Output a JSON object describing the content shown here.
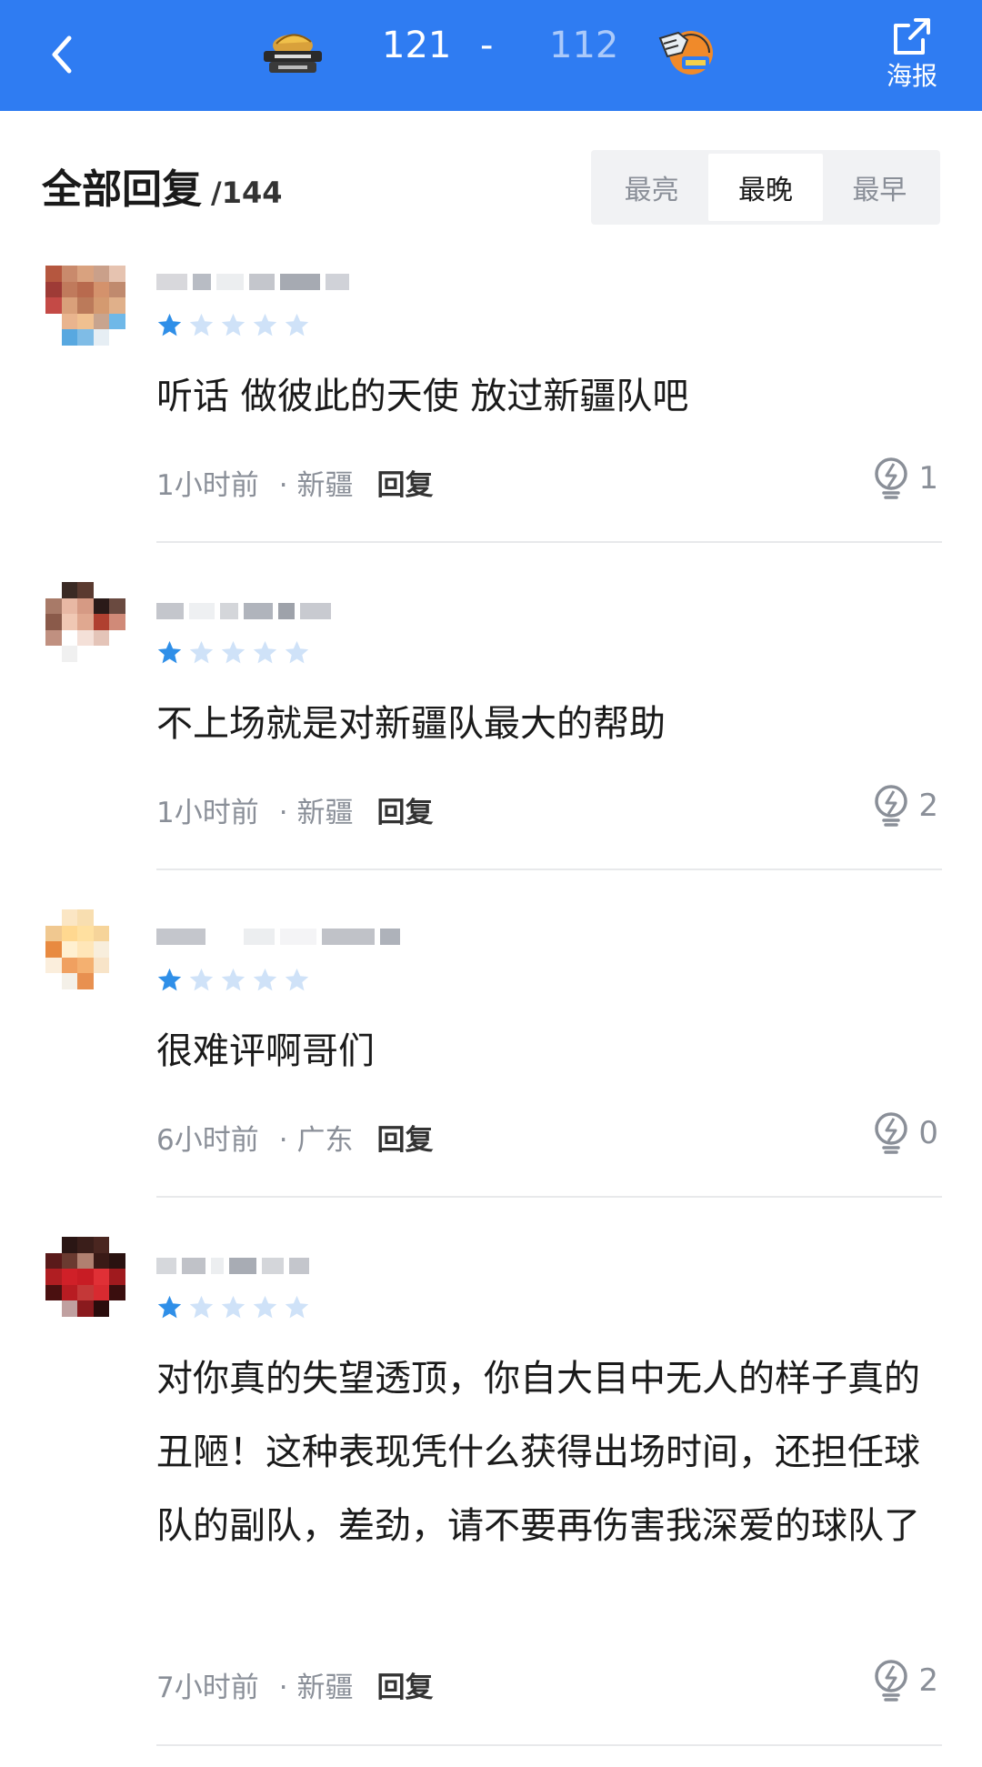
{
  "header": {
    "home_score": "121",
    "separator": "-",
    "away_score": "112",
    "share_label": "海报",
    "accent": "#2f7cf2"
  },
  "replies": {
    "title": "全部回复",
    "count": "/144",
    "sort_tabs": [
      "最亮",
      "最晚",
      "最早"
    ],
    "active_tab": "最晚"
  },
  "comments": [
    {
      "rating": 1,
      "text": "听话 做彼此的天使 放过新疆队吧",
      "time": "1小时前",
      "location": "· 新疆",
      "reply_label": "回复",
      "likes": "1"
    },
    {
      "rating": 1,
      "text": "不上场就是对新疆队最大的帮助",
      "time": "1小时前",
      "location": "· 新疆",
      "reply_label": "回复",
      "likes": "2"
    },
    {
      "rating": 1,
      "text": "很难评啊哥们",
      "time": "6小时前",
      "location": "· 广东",
      "reply_label": "回复",
      "likes": "0"
    },
    {
      "rating": 1,
      "text": "对你真的失望透顶，你自大目中无人的样子真的丑陋！这种表现凭什么获得出场时间，还担任球队的副队，差劲，请不要再伤害我深爱的球队了",
      "time": "7小时前",
      "location": "· 新疆",
      "reply_label": "回复",
      "likes": "2"
    }
  ]
}
